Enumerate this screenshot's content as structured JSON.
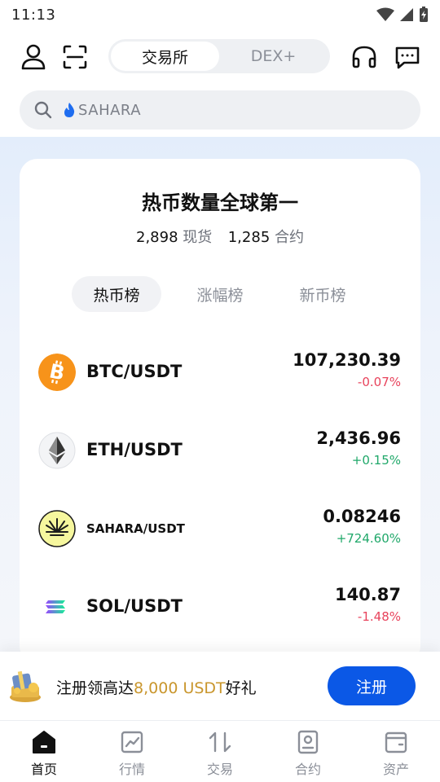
{
  "status_bar": {
    "time": "11:13"
  },
  "header": {
    "segments": [
      "交易所",
      "DEX+"
    ]
  },
  "search": {
    "placeholder": "SAHARA"
  },
  "hero": {
    "title": "热币数量全球第一",
    "spot_count": "2,898",
    "spot_label": "现货",
    "futures_count": "1,285",
    "futures_label": "合约",
    "tabs": [
      "热币榜",
      "涨幅榜",
      "新币榜"
    ]
  },
  "markets": [
    {
      "pair": "BTC/USDT",
      "price": "107,230.39",
      "change": "-0.07%",
      "direction": "down"
    },
    {
      "pair": "ETH/USDT",
      "price": "2,436.96",
      "change": "+0.15%",
      "direction": "up"
    },
    {
      "pair": "SAHARA/USDT",
      "price": "0.08246",
      "change": "+724.60%",
      "direction": "up"
    },
    {
      "pair": "SOL/USDT",
      "price": "140.87",
      "change": "-1.48%",
      "direction": "down"
    }
  ],
  "promo": {
    "text_before": "注册领高达",
    "highlight": "8,000 USDT",
    "text_after": "好礼",
    "button": "注册"
  },
  "tabbar": {
    "items": [
      {
        "label": "首页",
        "icon": "home-icon",
        "active": true
      },
      {
        "label": "行情",
        "icon": "market-chart-icon",
        "active": false
      },
      {
        "label": "交易",
        "icon": "trade-arrows-icon",
        "active": false
      },
      {
        "label": "合约",
        "icon": "futures-icon",
        "active": false
      },
      {
        "label": "资产",
        "icon": "wallet-icon",
        "active": false
      }
    ]
  },
  "colors": {
    "accent": "#0b58e6",
    "negative": "#e8435c",
    "positive": "#20a86a",
    "promo_highlight": "#c9962d"
  }
}
